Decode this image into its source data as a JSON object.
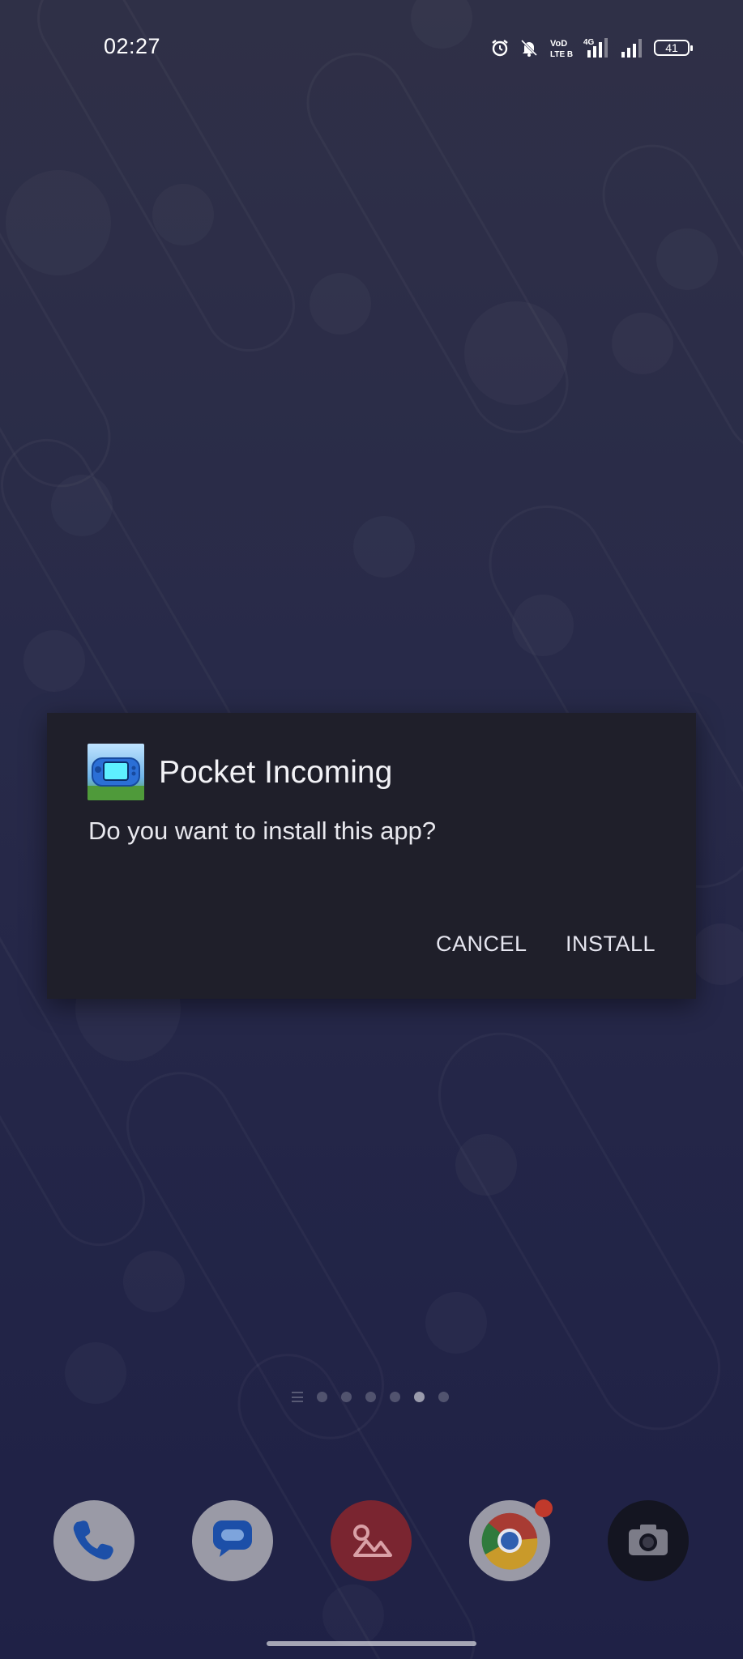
{
  "status_bar": {
    "time": "02:27",
    "battery_level": "41",
    "network_label": "4G",
    "volte_label_top": "VoD",
    "volte_label_bottom": "LTE B",
    "icons": [
      "alarm-icon",
      "mute-icon",
      "volte-icon",
      "signal-4g-icon",
      "signal-icon",
      "battery-icon"
    ]
  },
  "dialog": {
    "app_name": "Pocket Incoming",
    "question": "Do you want to install this app?",
    "cancel_label": "CANCEL",
    "install_label": "INSTALL"
  },
  "home": {
    "page_count": 6,
    "active_page": 5
  },
  "dock": {
    "apps": [
      "Phone",
      "Messages",
      "Gallery",
      "Chrome",
      "Camera"
    ],
    "chrome_badge_color": "#e53935"
  },
  "colors": {
    "dialog_bg": "#1f1f2a",
    "wallpaper_top": "#3a3b58",
    "wallpaper_bottom": "#232656"
  }
}
